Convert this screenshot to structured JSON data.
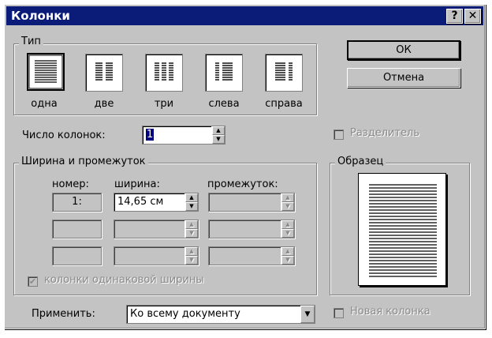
{
  "window": {
    "title": "Колонки",
    "help_btn": "?",
    "close_btn": "✕"
  },
  "type_group": {
    "label": "Тип",
    "presets": [
      {
        "label": "одна"
      },
      {
        "label": "две"
      },
      {
        "label": "три"
      },
      {
        "label": "слева"
      },
      {
        "label": "справа"
      }
    ],
    "selected": "одна"
  },
  "buttons": {
    "ok": "ОК",
    "cancel": "Отмена"
  },
  "num_columns": {
    "label": "Число колонок:",
    "value": "1"
  },
  "separator": {
    "label": "Разделитель",
    "checked": false,
    "enabled": false
  },
  "width_group": {
    "label": "Ширина и промежуток",
    "col_header": "номер:",
    "width_header": "ширина:",
    "spacing_header": "промежуток:",
    "rows": [
      {
        "number": "1:",
        "width": "14,65 см",
        "spacing": ""
      },
      {
        "number": "",
        "width": "",
        "spacing": ""
      },
      {
        "number": "",
        "width": "",
        "spacing": ""
      }
    ],
    "equal_width": {
      "label": "колонки одинаковой ширины",
      "checked": true,
      "enabled": false
    }
  },
  "preview_group": {
    "label": "Образец"
  },
  "apply": {
    "label": "Применить:",
    "value": "Ко всему документу"
  },
  "new_column": {
    "label": "Новая колонка",
    "checked": false,
    "enabled": false
  }
}
